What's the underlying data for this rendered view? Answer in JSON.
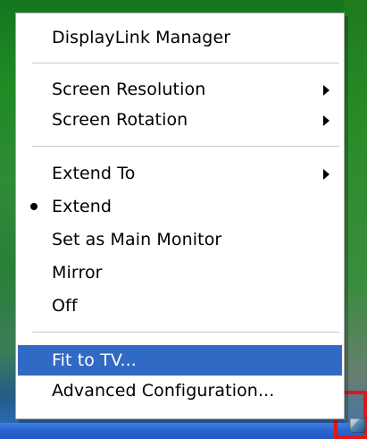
{
  "menu": {
    "items": [
      {
        "label": "DisplayLink Manager",
        "submenu": false,
        "selected": false
      },
      {
        "label": "Screen Resolution",
        "submenu": true,
        "selected": false
      },
      {
        "label": "Screen Rotation",
        "submenu": true,
        "selected": false
      },
      {
        "label": "Extend To",
        "submenu": true,
        "selected": false
      },
      {
        "label": "Extend",
        "submenu": false,
        "selected": false,
        "bullet": true
      },
      {
        "label": "Set as Main Monitor",
        "submenu": false,
        "selected": false
      },
      {
        "label": "Mirror",
        "submenu": false,
        "selected": false
      },
      {
        "label": "Off",
        "submenu": false,
        "selected": false
      },
      {
        "label": "Fit to TV...",
        "submenu": false,
        "selected": true
      },
      {
        "label": "Advanced Configuration...",
        "submenu": false,
        "selected": false
      }
    ]
  },
  "icons": {
    "submenu_arrow": "submenu-arrow-icon",
    "bullet": "bullet-icon",
    "tray_app": "displaylink-tray-icon"
  },
  "colors": {
    "menu_background": "#ffffff",
    "selected_background": "#316ac5",
    "highlight_box": "#e01717"
  }
}
